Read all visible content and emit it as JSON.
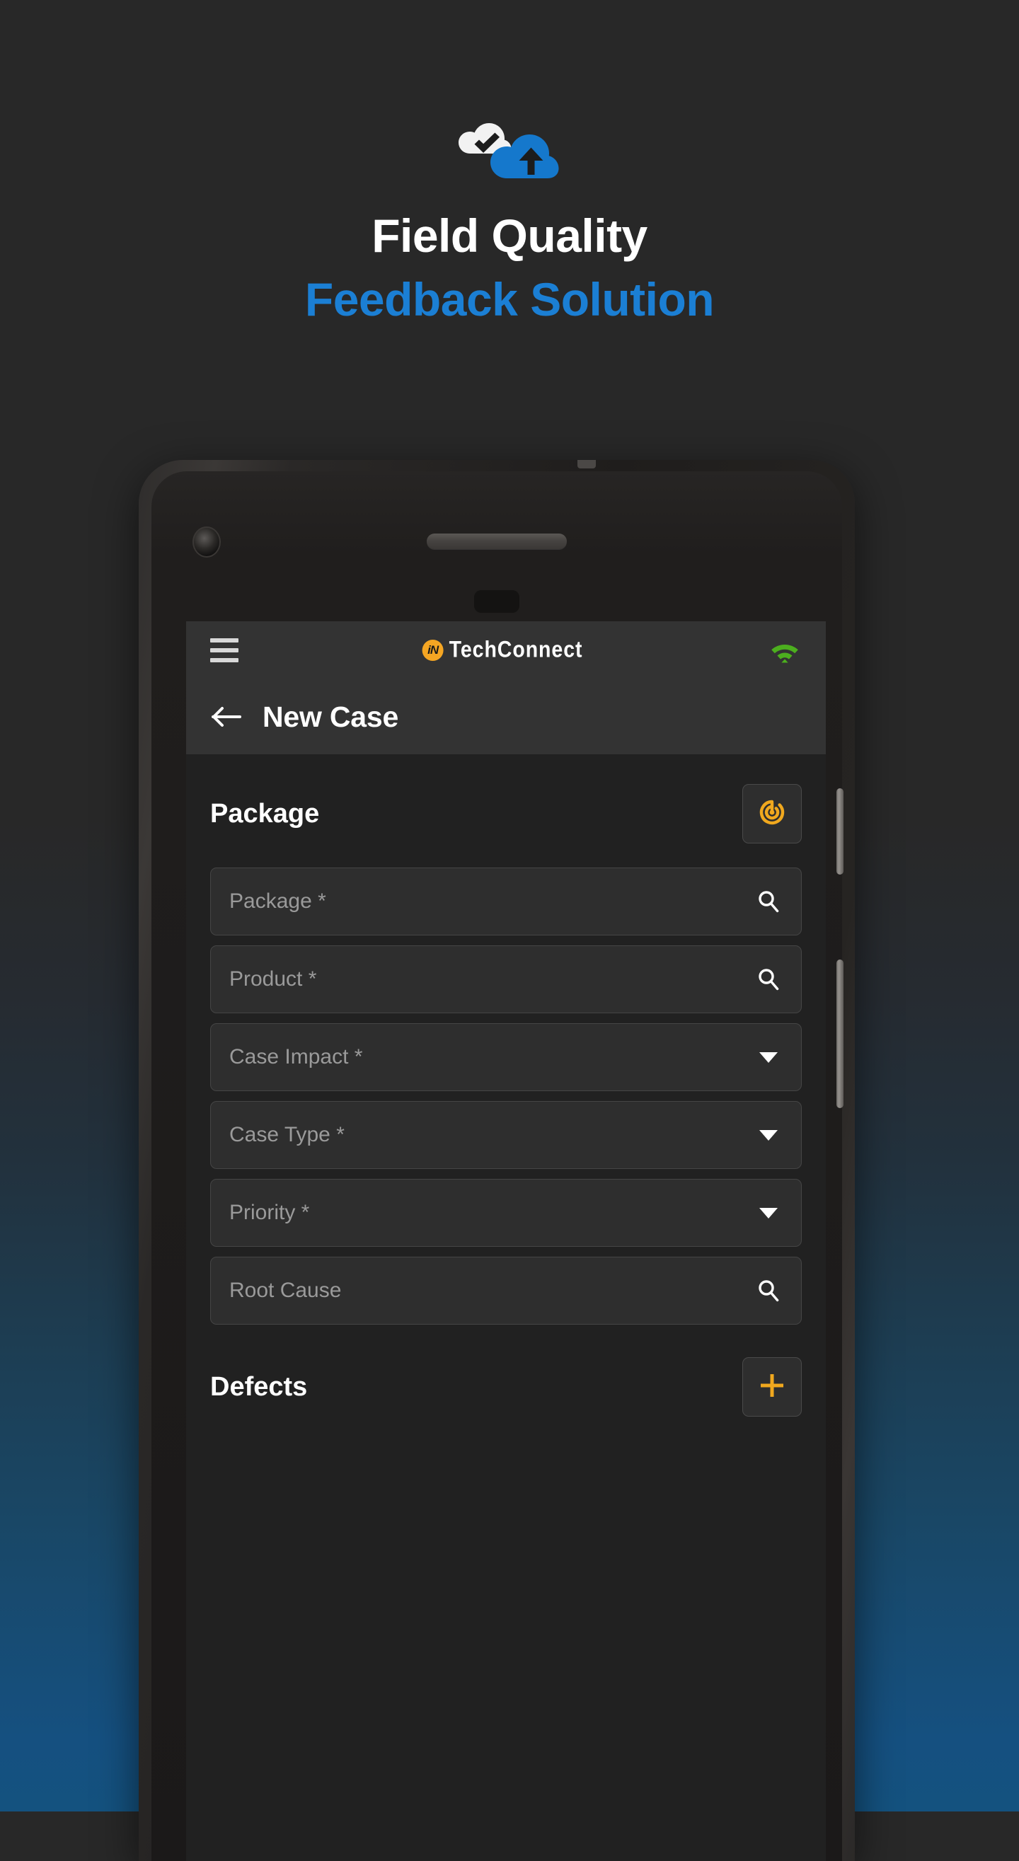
{
  "hero": {
    "logo_icon": "cloud-check-upload-logo",
    "title_line1": "Field Quality",
    "title_line2": "Feedback Solution",
    "accent_color": "#1b7fd4",
    "title_color": "#ffffff"
  },
  "app": {
    "appbar": {
      "menu_icon": "hamburger-menu-icon",
      "brand_mark": "iN",
      "brand_name": "TechConnect",
      "brand_mark_color": "#f5a623",
      "status_icon": "wifi-icon",
      "status_icon_color": "#4caf1e"
    },
    "subheader": {
      "back_icon": "back-arrow-icon",
      "title": "New Case"
    },
    "package_section": {
      "title": "Package",
      "action_icon": "scan-radar-icon",
      "action_icon_color": "#f0a81e"
    },
    "fields": [
      {
        "label": "Package *",
        "icon": "search-icon",
        "type": "search"
      },
      {
        "label": "Product *",
        "icon": "search-icon",
        "type": "search"
      },
      {
        "label": "Case Impact *",
        "icon": "chevron-down-icon",
        "type": "select"
      },
      {
        "label": "Case Type *",
        "icon": "chevron-down-icon",
        "type": "select"
      },
      {
        "label": "Priority *",
        "icon": "chevron-down-icon",
        "type": "select"
      },
      {
        "label": "Root Cause",
        "icon": "search-icon",
        "type": "search"
      }
    ],
    "defects_section": {
      "title": "Defects",
      "action_icon": "plus-add-icon",
      "action_icon_color": "#f0a81e"
    }
  }
}
